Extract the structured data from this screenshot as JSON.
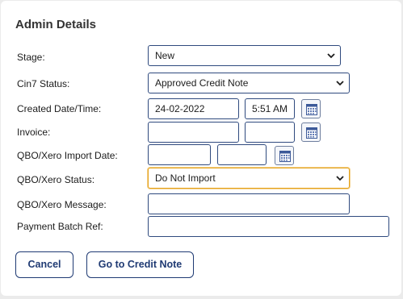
{
  "panel": {
    "title": "Admin Details"
  },
  "fields": {
    "stage": {
      "label": "Stage:",
      "value": "New"
    },
    "cin7_status": {
      "label": "Cin7 Status:",
      "value": "Approved Credit Note"
    },
    "created": {
      "label": "Created Date/Time:",
      "date": "24-02-2022",
      "time": "5:51 AM"
    },
    "invoice": {
      "label": "Invoice:",
      "date": "",
      "time": ""
    },
    "qbo_import_date": {
      "label": "QBO/Xero Import Date:",
      "date": "",
      "time": ""
    },
    "qbo_status": {
      "label": "QBO/Xero Status:",
      "value": "Do Not Import"
    },
    "qbo_message": {
      "label": "QBO/Xero Message:",
      "value": ""
    },
    "payment_batch_ref": {
      "label": "Payment Batch Ref:",
      "value": ""
    }
  },
  "buttons": {
    "cancel": "Cancel",
    "go_to_credit_note": "Go to Credit Note"
  },
  "icons": {
    "dropdown": "chevron-down-icon",
    "calendar": "calendar-icon"
  },
  "colors": {
    "border": "#2f4a7e",
    "focus": "#e4a21b",
    "button_text": "#1f3a73"
  }
}
